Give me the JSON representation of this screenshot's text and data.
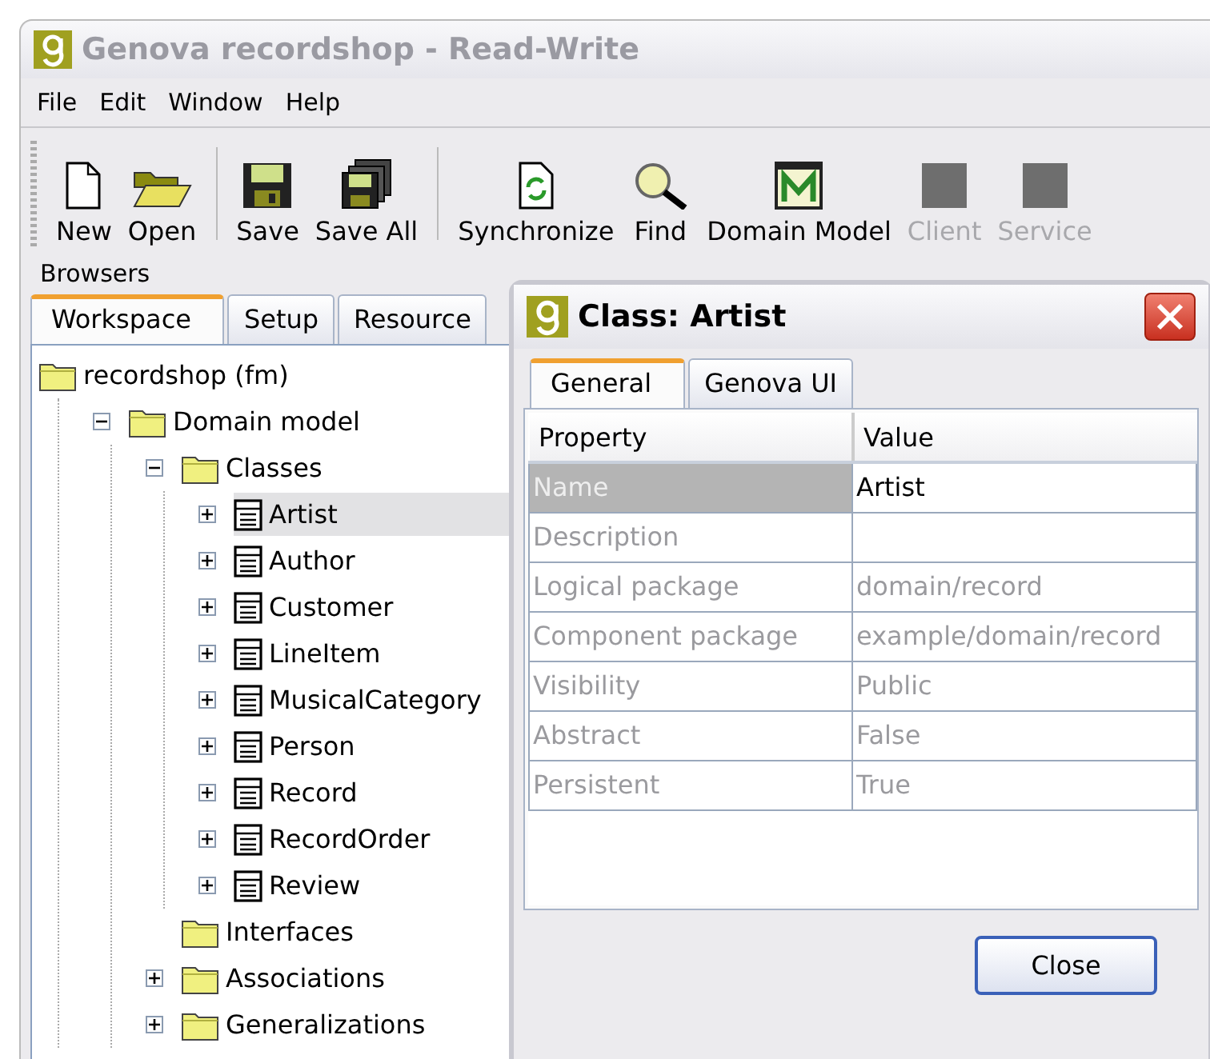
{
  "window": {
    "title": "Genova recordshop - Read-Write"
  },
  "menu": [
    "File",
    "Edit",
    "Window",
    "Help"
  ],
  "toolbar": {
    "groups": [
      [
        {
          "label": "New",
          "kind": "new",
          "disabled": false
        },
        {
          "label": "Open",
          "kind": "open",
          "disabled": false
        }
      ],
      [
        {
          "label": "Save",
          "kind": "save",
          "disabled": false
        },
        {
          "label": "Save All",
          "kind": "saveall",
          "disabled": false
        }
      ],
      [
        {
          "label": "Synchronize",
          "kind": "sync",
          "disabled": false
        },
        {
          "label": "Find",
          "kind": "find",
          "disabled": false
        },
        {
          "label": "Domain Model",
          "kind": "model",
          "disabled": false
        },
        {
          "label": "Client",
          "kind": "block",
          "disabled": true
        },
        {
          "label": "Service",
          "kind": "block",
          "disabled": true
        }
      ]
    ]
  },
  "browsers": {
    "label": "Browsers",
    "tabs": [
      {
        "label": "Workspace",
        "selected": true
      },
      {
        "label": "Setup",
        "selected": false
      },
      {
        "label": "Resource",
        "selected": false
      }
    ],
    "tree": [
      {
        "label": "recordshop (fm)",
        "kind": "folder",
        "selected": false,
        "children": [
          {
            "label": "Domain model",
            "kind": "folder",
            "expanded": true,
            "selected": false,
            "children": [
              {
                "label": "Classes",
                "kind": "folder",
                "expanded": true,
                "selected": false,
                "children": [
                  {
                    "label": "Artist",
                    "kind": "class",
                    "expanded": false,
                    "selected": true
                  },
                  {
                    "label": "Author",
                    "kind": "class",
                    "expanded": false,
                    "selected": false
                  },
                  {
                    "label": "Customer",
                    "kind": "class",
                    "expanded": false,
                    "selected": false
                  },
                  {
                    "label": "LineItem",
                    "kind": "class",
                    "expanded": false,
                    "selected": false
                  },
                  {
                    "label": "MusicalCategory",
                    "kind": "class",
                    "expanded": false,
                    "selected": false
                  },
                  {
                    "label": "Person",
                    "kind": "class",
                    "expanded": false,
                    "selected": false
                  },
                  {
                    "label": "Record",
                    "kind": "class",
                    "expanded": false,
                    "selected": false
                  },
                  {
                    "label": "RecordOrder",
                    "kind": "class",
                    "expanded": false,
                    "selected": false
                  },
                  {
                    "label": "Review",
                    "kind": "class",
                    "expanded": false,
                    "selected": false
                  }
                ]
              },
              {
                "label": "Interfaces",
                "kind": "folder",
                "selected": false
              },
              {
                "label": "Associations",
                "kind": "folder",
                "expanded": false,
                "selected": false
              },
              {
                "label": "Generalizations",
                "kind": "folder",
                "expanded": false,
                "selected": false
              }
            ]
          }
        ]
      }
    ]
  },
  "dialog": {
    "title": "Class: Artist",
    "tabs": [
      {
        "label": "General",
        "selected": true
      },
      {
        "label": "Genova UI",
        "selected": false
      }
    ],
    "table": {
      "columns": [
        "Property",
        "Value"
      ],
      "rows": [
        {
          "property": "Name",
          "value": "Artist",
          "selected": true
        },
        {
          "property": "Description",
          "selected": false
        },
        {
          "property": "Logical package",
          "value": "domain/record",
          "selected": false
        },
        {
          "property": "Component package",
          "value": "example/domain/record",
          "selected": false
        },
        {
          "property": "Visibility",
          "value": "Public",
          "selected": false
        },
        {
          "property": "Abstract",
          "value": "False",
          "selected": false
        },
        {
          "property": "Persistent",
          "value": "True",
          "selected": false
        }
      ]
    },
    "buttons": [
      "Close"
    ]
  }
}
